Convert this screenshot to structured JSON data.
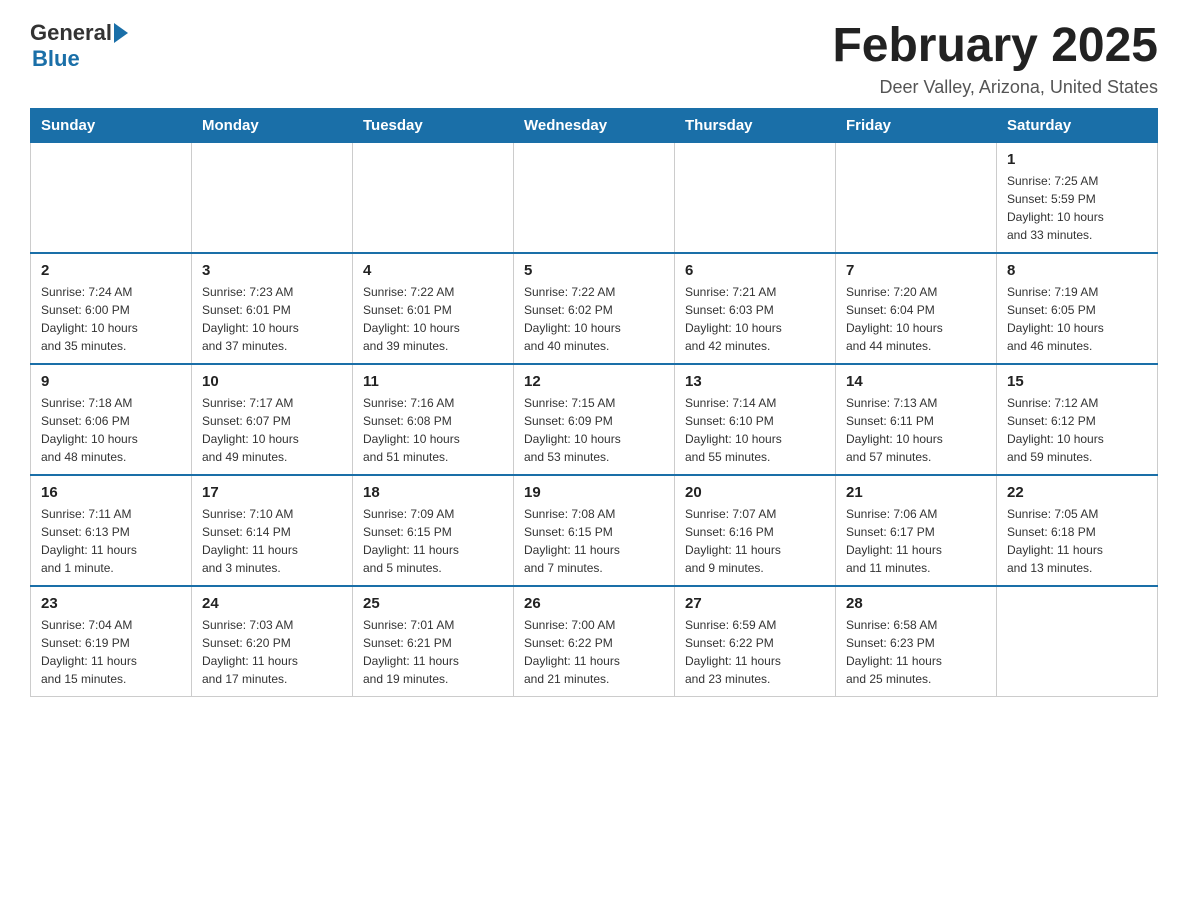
{
  "header": {
    "logo_general": "General",
    "logo_blue": "Blue",
    "month_title": "February 2025",
    "location": "Deer Valley, Arizona, United States"
  },
  "weekdays": [
    "Sunday",
    "Monday",
    "Tuesday",
    "Wednesday",
    "Thursday",
    "Friday",
    "Saturday"
  ],
  "weeks": [
    [
      {
        "day": "",
        "info": ""
      },
      {
        "day": "",
        "info": ""
      },
      {
        "day": "",
        "info": ""
      },
      {
        "day": "",
        "info": ""
      },
      {
        "day": "",
        "info": ""
      },
      {
        "day": "",
        "info": ""
      },
      {
        "day": "1",
        "info": "Sunrise: 7:25 AM\nSunset: 5:59 PM\nDaylight: 10 hours\nand 33 minutes."
      }
    ],
    [
      {
        "day": "2",
        "info": "Sunrise: 7:24 AM\nSunset: 6:00 PM\nDaylight: 10 hours\nand 35 minutes."
      },
      {
        "day": "3",
        "info": "Sunrise: 7:23 AM\nSunset: 6:01 PM\nDaylight: 10 hours\nand 37 minutes."
      },
      {
        "day": "4",
        "info": "Sunrise: 7:22 AM\nSunset: 6:01 PM\nDaylight: 10 hours\nand 39 minutes."
      },
      {
        "day": "5",
        "info": "Sunrise: 7:22 AM\nSunset: 6:02 PM\nDaylight: 10 hours\nand 40 minutes."
      },
      {
        "day": "6",
        "info": "Sunrise: 7:21 AM\nSunset: 6:03 PM\nDaylight: 10 hours\nand 42 minutes."
      },
      {
        "day": "7",
        "info": "Sunrise: 7:20 AM\nSunset: 6:04 PM\nDaylight: 10 hours\nand 44 minutes."
      },
      {
        "day": "8",
        "info": "Sunrise: 7:19 AM\nSunset: 6:05 PM\nDaylight: 10 hours\nand 46 minutes."
      }
    ],
    [
      {
        "day": "9",
        "info": "Sunrise: 7:18 AM\nSunset: 6:06 PM\nDaylight: 10 hours\nand 48 minutes."
      },
      {
        "day": "10",
        "info": "Sunrise: 7:17 AM\nSunset: 6:07 PM\nDaylight: 10 hours\nand 49 minutes."
      },
      {
        "day": "11",
        "info": "Sunrise: 7:16 AM\nSunset: 6:08 PM\nDaylight: 10 hours\nand 51 minutes."
      },
      {
        "day": "12",
        "info": "Sunrise: 7:15 AM\nSunset: 6:09 PM\nDaylight: 10 hours\nand 53 minutes."
      },
      {
        "day": "13",
        "info": "Sunrise: 7:14 AM\nSunset: 6:10 PM\nDaylight: 10 hours\nand 55 minutes."
      },
      {
        "day": "14",
        "info": "Sunrise: 7:13 AM\nSunset: 6:11 PM\nDaylight: 10 hours\nand 57 minutes."
      },
      {
        "day": "15",
        "info": "Sunrise: 7:12 AM\nSunset: 6:12 PM\nDaylight: 10 hours\nand 59 minutes."
      }
    ],
    [
      {
        "day": "16",
        "info": "Sunrise: 7:11 AM\nSunset: 6:13 PM\nDaylight: 11 hours\nand 1 minute."
      },
      {
        "day": "17",
        "info": "Sunrise: 7:10 AM\nSunset: 6:14 PM\nDaylight: 11 hours\nand 3 minutes."
      },
      {
        "day": "18",
        "info": "Sunrise: 7:09 AM\nSunset: 6:15 PM\nDaylight: 11 hours\nand 5 minutes."
      },
      {
        "day": "19",
        "info": "Sunrise: 7:08 AM\nSunset: 6:15 PM\nDaylight: 11 hours\nand 7 minutes."
      },
      {
        "day": "20",
        "info": "Sunrise: 7:07 AM\nSunset: 6:16 PM\nDaylight: 11 hours\nand 9 minutes."
      },
      {
        "day": "21",
        "info": "Sunrise: 7:06 AM\nSunset: 6:17 PM\nDaylight: 11 hours\nand 11 minutes."
      },
      {
        "day": "22",
        "info": "Sunrise: 7:05 AM\nSunset: 6:18 PM\nDaylight: 11 hours\nand 13 minutes."
      }
    ],
    [
      {
        "day": "23",
        "info": "Sunrise: 7:04 AM\nSunset: 6:19 PM\nDaylight: 11 hours\nand 15 minutes."
      },
      {
        "day": "24",
        "info": "Sunrise: 7:03 AM\nSunset: 6:20 PM\nDaylight: 11 hours\nand 17 minutes."
      },
      {
        "day": "25",
        "info": "Sunrise: 7:01 AM\nSunset: 6:21 PM\nDaylight: 11 hours\nand 19 minutes."
      },
      {
        "day": "26",
        "info": "Sunrise: 7:00 AM\nSunset: 6:22 PM\nDaylight: 11 hours\nand 21 minutes."
      },
      {
        "day": "27",
        "info": "Sunrise: 6:59 AM\nSunset: 6:22 PM\nDaylight: 11 hours\nand 23 minutes."
      },
      {
        "day": "28",
        "info": "Sunrise: 6:58 AM\nSunset: 6:23 PM\nDaylight: 11 hours\nand 25 minutes."
      },
      {
        "day": "",
        "info": ""
      }
    ]
  ]
}
